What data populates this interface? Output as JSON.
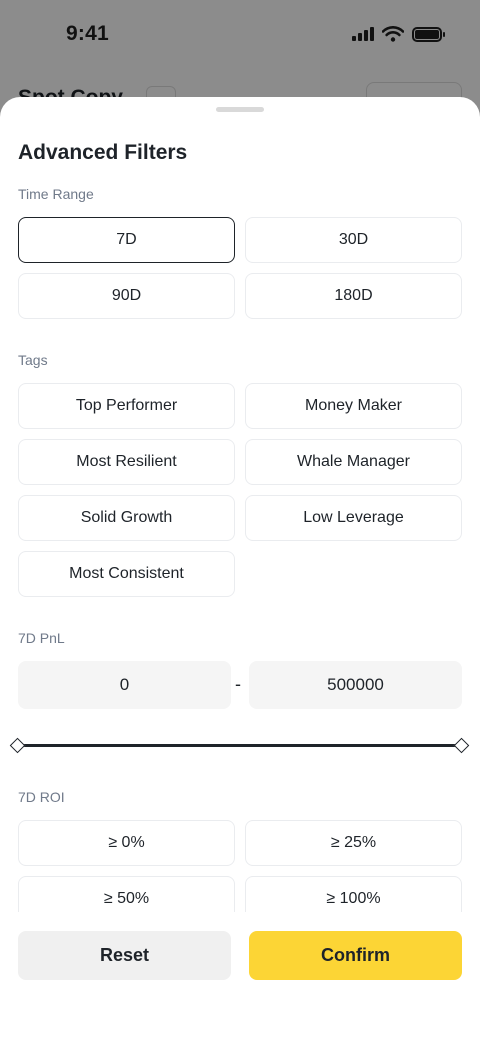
{
  "status_bar": {
    "time": "9:41"
  },
  "background_page": {
    "title": "Spot Copy"
  },
  "sheet": {
    "title": "Advanced Filters",
    "time_range": {
      "label": "Time Range",
      "options": [
        "7D",
        "30D",
        "90D",
        "180D"
      ],
      "selected": "7D"
    },
    "tags": {
      "label": "Tags",
      "options": [
        "Top Performer",
        "Money Maker",
        "Most Resilient",
        "Whale Manager",
        "Solid Growth",
        "Low Leverage",
        "Most Consistent"
      ]
    },
    "pnl": {
      "label": "7D PnL",
      "min_value": "0",
      "separator": "-",
      "max_value": "500000"
    },
    "roi": {
      "label": "7D ROI",
      "options": [
        "≥ 0%",
        "≥ 25%",
        "≥ 50%",
        "≥ 100%"
      ]
    },
    "footer": {
      "reset_label": "Reset",
      "confirm_label": "Confirm"
    }
  },
  "colors": {
    "accent": "#fcd535",
    "text": "#1e2329",
    "muted": "#707a8a",
    "chip_border": "#eaecef"
  }
}
